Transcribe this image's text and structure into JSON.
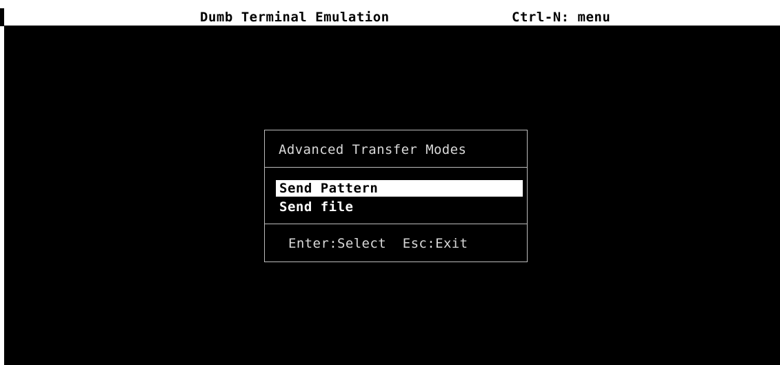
{
  "title_bar": {
    "title": "Dumb Terminal Emulation",
    "menu_hint": "Ctrl-N: menu"
  },
  "dialog": {
    "title": "Advanced Transfer Modes",
    "items": [
      {
        "label": "Send Pattern",
        "selected": true
      },
      {
        "label": "Send file",
        "selected": false
      }
    ],
    "footer": "Enter:Select  Esc:Exit"
  },
  "colors": {
    "background": "#000000",
    "title_bar": "#ffffff",
    "selection": "#ffffff",
    "border": "#bdbdbd"
  }
}
